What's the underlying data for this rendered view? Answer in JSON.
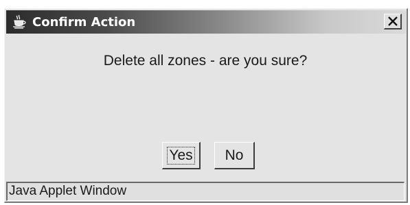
{
  "window": {
    "title": "Confirm Action",
    "icon": "java-coffee-cup-icon",
    "close_icon": "close-icon"
  },
  "dialog": {
    "message": "Delete all zones - are you sure?",
    "yes_label": "Yes",
    "no_label": "No",
    "default_button": "Yes"
  },
  "status": {
    "text": "Java Applet Window"
  }
}
